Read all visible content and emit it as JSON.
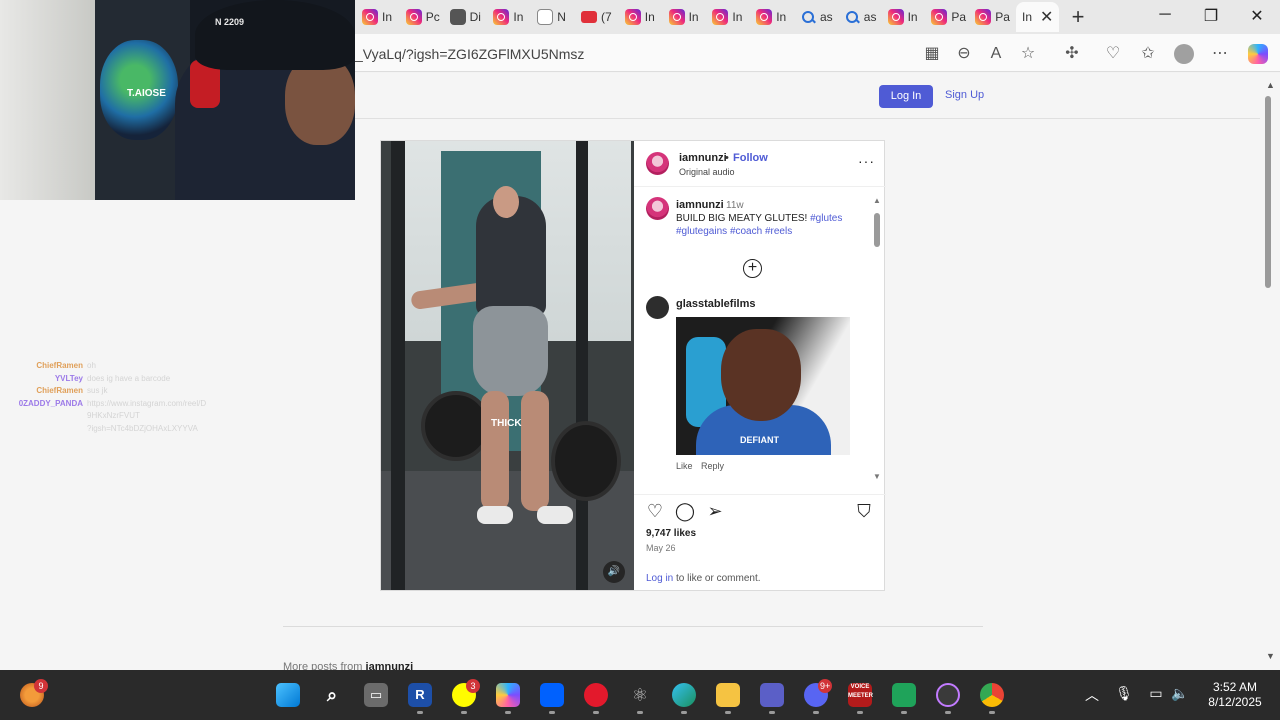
{
  "browser": {
    "tabs": [
      {
        "label": "In",
        "icon": "instagram-icon"
      },
      {
        "label": "Pc",
        "icon": "instagram-icon"
      },
      {
        "label": "Di",
        "icon": "tiktok-icon"
      },
      {
        "label": "In",
        "icon": "instagram-icon"
      },
      {
        "label": "N",
        "icon": "page-icon"
      },
      {
        "label": "(7",
        "icon": "youtube-icon"
      },
      {
        "label": "In",
        "icon": "instagram-icon"
      },
      {
        "label": "In",
        "icon": "instagram-icon"
      },
      {
        "label": "In",
        "icon": "instagram-icon"
      },
      {
        "label": "In",
        "icon": "instagram-icon"
      },
      {
        "label": "as",
        "icon": "search-icon"
      },
      {
        "label": "as",
        "icon": "search-icon"
      },
      {
        "label": "In",
        "icon": "instagram-icon"
      },
      {
        "label": "Pa",
        "icon": "instagram-icon"
      },
      {
        "label": "Pa",
        "icon": "instagram-icon"
      }
    ],
    "active_tab": {
      "label": "In",
      "close": "✕"
    },
    "new_tab": "+",
    "window_controls": {
      "minimize": "─",
      "maximize": "❐",
      "close": "✕"
    },
    "url": "_VyaLq/?igsh=ZGI6ZGFlMXU5Nmsz",
    "accent": "#4f5bd5"
  },
  "instagram": {
    "header": {
      "login": "Log In",
      "signup": "Sign Up"
    },
    "post": {
      "video_caption": "THICK",
      "sound": "🔊",
      "author": "iamnunzi",
      "separator": "•",
      "follow": "Follow",
      "audio": "Original audio",
      "more": "···",
      "caption": {
        "author": "iamnunzi",
        "age": "11w",
        "text": "BUILD BIG MEATY GLUTES!",
        "hashtags": [
          "#glutes",
          "#glutegains",
          "#coach",
          "#reels"
        ]
      },
      "load_more": "+",
      "comment": {
        "author": "glasstablefilms",
        "jersey_text": "DEFIANT",
        "like": "Like",
        "reply": "Reply"
      },
      "likes": "9,747 likes",
      "date": "May 26",
      "login_link": "Log in",
      "login_suffix": " to like or comment.",
      "more_posts_prefix": "More posts from ",
      "more_posts_user": "iamnunzi"
    }
  },
  "stream": {
    "webcam_logo": "T.AIOSE",
    "webcam_cap_brand": "N 2209",
    "chat": [
      {
        "name": "ChiefRamen",
        "color": "#e0a05a",
        "message": "oh"
      },
      {
        "name": "YVLTey",
        "color": "#9c7ae8",
        "message": "does ig have a barcode"
      },
      {
        "name": "ChiefRamen",
        "color": "#e0a05a",
        "message": "sus jk"
      },
      {
        "name": "0ZADDY_PANDA",
        "color": "#9c7ae8",
        "message": "https://www.instagram.com/reel/D"
      },
      {
        "name": "",
        "color": "#9c7ae8",
        "message": "9HKxNzrFVUT"
      },
      {
        "name": "",
        "color": "#9c7ae8",
        "message": "?igsh=NTc4bDZjOHAxLXYYVA"
      }
    ]
  },
  "taskbar": {
    "apps": [
      {
        "name": "wolf-app-icon",
        "badge": "9"
      },
      {
        "name": "windows-start-icon"
      },
      {
        "name": "search-icon"
      },
      {
        "name": "task-view-icon"
      },
      {
        "name": "r-app-icon",
        "label": "R"
      },
      {
        "name": "snapchat-icon",
        "badge": "3"
      },
      {
        "name": "copilot-icon"
      },
      {
        "name": "dropbox-icon"
      },
      {
        "name": "opera-icon"
      },
      {
        "name": "react-icon"
      },
      {
        "name": "edge-icon"
      },
      {
        "name": "file-explorer-icon"
      },
      {
        "name": "teams-icon"
      },
      {
        "name": "discord-icon",
        "badge": "9+"
      },
      {
        "name": "voicemeeter-icon",
        "label": "VOICE MEETER"
      },
      {
        "name": "streamer-bot-icon"
      },
      {
        "name": "media-player-icon"
      },
      {
        "name": "chrome-icon"
      }
    ],
    "time": "3:52 AM",
    "date": "8/12/2025"
  }
}
